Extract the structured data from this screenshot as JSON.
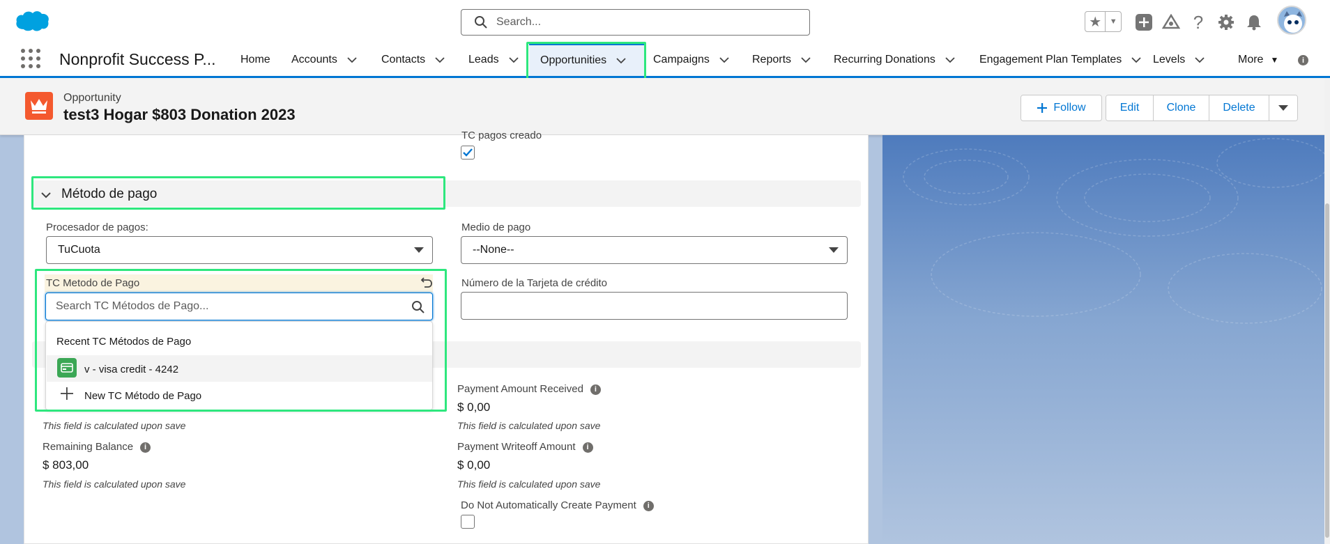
{
  "global_header": {
    "search_placeholder": "Search..."
  },
  "nav": {
    "app_name": "Nonprofit Success P...",
    "items": [
      {
        "label": "Home"
      },
      {
        "label": "Accounts"
      },
      {
        "label": "Contacts"
      },
      {
        "label": "Leads"
      },
      {
        "label": "Opportunities",
        "active": true
      },
      {
        "label": "Campaigns"
      },
      {
        "label": "Reports"
      },
      {
        "label": "Recurring Donations"
      },
      {
        "label": "Engagement Plan Templates"
      },
      {
        "label": "Levels"
      },
      {
        "label": "More"
      }
    ]
  },
  "record": {
    "type": "Opportunity",
    "title": "test3 Hogar $803 Donation 2023",
    "buttons": {
      "follow": "Follow",
      "edit": "Edit",
      "clone": "Clone",
      "delete": "Delete"
    }
  },
  "form": {
    "tc_pagos_creado_label": "TC pagos creado",
    "tc_pagos_creado_checked": true,
    "section_title": "Método de pago",
    "procesador_label": "Procesador de pagos:",
    "procesador_value": "TuCuota",
    "medio_label": "Medio de pago",
    "medio_value": "--None--",
    "tc_metodo_label": "TC Metodo de Pago",
    "tc_metodo_placeholder": "Search TC Métodos de Pago...",
    "numero_tarjeta_label": "Número de la Tarjeta de crédito",
    "lookup_dropdown": {
      "header": "Recent TC Métodos de Pago",
      "items": [
        "v - visa credit - 4242"
      ],
      "new_label": "New TC Método de Pago"
    },
    "payment_amount_received_label": "Payment Amount Received",
    "payment_amount_received_value": "$ 0,00",
    "payment_amount_received_hint": "This field is calculated upon save",
    "left_hint_1": "This field is calculated upon save",
    "remaining_balance_label": "Remaining Balance",
    "remaining_balance_value": "$ 803,00",
    "remaining_balance_hint": "This field is calculated upon save",
    "payment_writeoff_label": "Payment Writeoff Amount",
    "payment_writeoff_value": "$ 0,00",
    "payment_writeoff_hint": "This field is calculated upon save",
    "do_not_create_label": "Do Not Automatically Create Payment",
    "do_not_create_checked": false
  },
  "colors": {
    "brand_blue": "#0176d3",
    "highlight_green": "#2ee77e",
    "record_icon_orange": "#f4592e"
  }
}
